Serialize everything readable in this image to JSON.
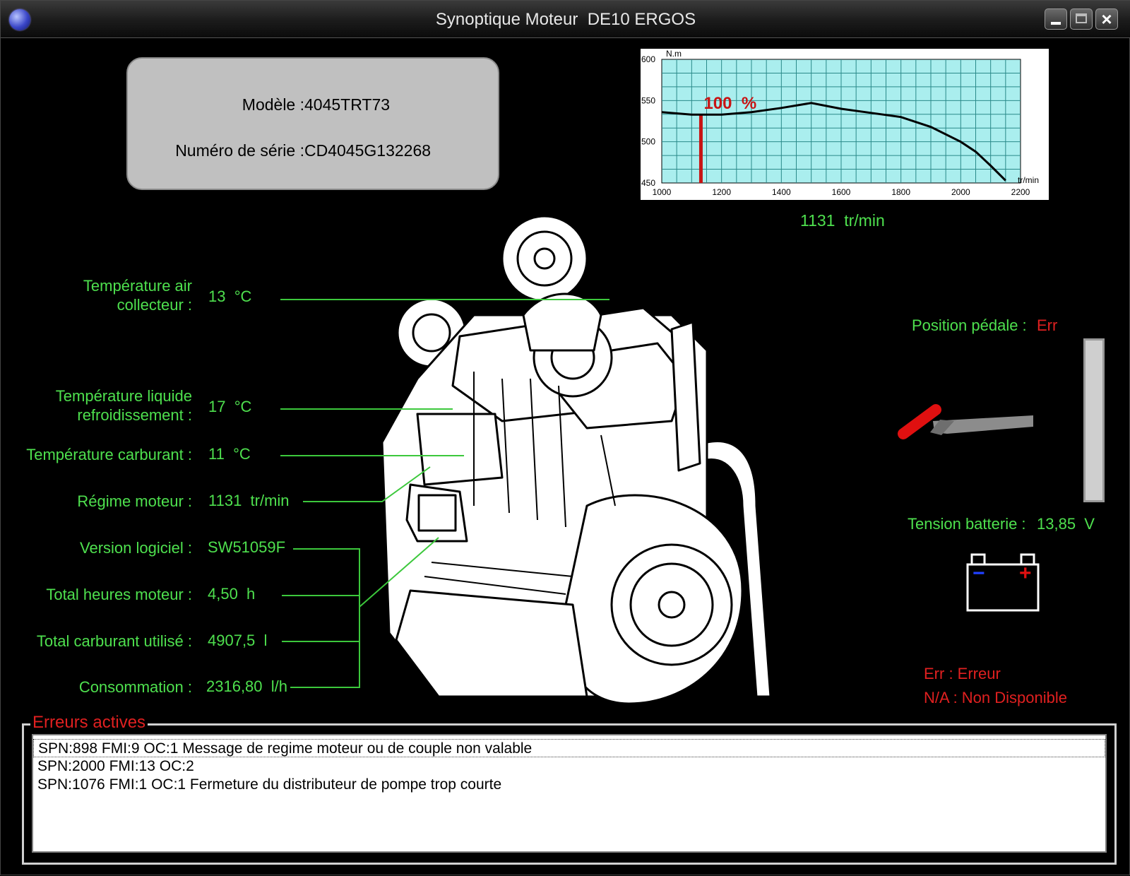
{
  "window": {
    "title": "Synoptique Moteur  DE10 ERGOS"
  },
  "info": {
    "model_label": "Modèle :",
    "model_value": "4045TRT73",
    "serial_label": "Numéro de série :",
    "serial_value": "CD4045G132268"
  },
  "chart_data": {
    "type": "line",
    "title": "",
    "ylabel": "N.m",
    "xlabel": "tr/min",
    "xlim": [
      1000,
      2200
    ],
    "ylim": [
      450,
      600
    ],
    "x_ticks": [
      1000,
      1200,
      1400,
      1600,
      1800,
      2000,
      2200
    ],
    "y_ticks": [
      450,
      500,
      550,
      600
    ],
    "grid": true,
    "series": [
      {
        "x": [
          1000,
          1100,
          1200,
          1300,
          1400,
          1500,
          1600,
          1700,
          1800,
          1900,
          2000,
          2050,
          2100,
          2150
        ],
        "y": [
          536,
          533,
          533,
          536,
          541,
          547,
          540,
          535,
          530,
          518,
          500,
          488,
          471,
          453
        ]
      }
    ],
    "marker_x": 1131,
    "annotation": "100  %",
    "colors": {
      "line": "#000000",
      "marker": "#c81414",
      "plot_bg": "#aaeeee",
      "grid": "#2a8a8a"
    }
  },
  "chart_readout": "1131  tr/min",
  "params": {
    "air_temp": {
      "label": "Température air\ncollecteur :",
      "value": "13  °C"
    },
    "coolant_temp": {
      "label": "Température liquide\nrefroidissement :",
      "value": "17  °C"
    },
    "fuel_temp": {
      "label": "Température carburant :",
      "value": "11  °C"
    },
    "engine_speed": {
      "label": "Régime moteur :",
      "value": "1131  tr/min"
    },
    "software": {
      "label": "Version logiciel :",
      "value": "SW51059F"
    },
    "hours": {
      "label": "Total heures moteur :",
      "value": "4,50  h"
    },
    "fuel_used": {
      "label": "Total carburant utilisé :",
      "value": "4907,5  l"
    },
    "consumption": {
      "label": "Consommation :",
      "value": "2316,80  l/h"
    }
  },
  "pedal": {
    "label": "Position pédale :",
    "value": "Err"
  },
  "battery": {
    "label": "Tension batterie :",
    "value": "13,85  V",
    "minus": "−",
    "plus": "+"
  },
  "legend": {
    "err": "Err : Erreur",
    "na": "N/A : Non Disponible"
  },
  "errors": {
    "title": "Erreurs actives",
    "items": [
      "SPN:898 FMI:9 OC:1 Message de regime moteur ou de couple non valable",
      "SPN:2000 FMI:13 OC:2",
      "SPN:1076 FMI:1 OC:1 Fermeture du distributeur de pompe trop courte"
    ]
  },
  "icons": {
    "app": "globe-icon",
    "pedal": "accelerator-pedal-icon",
    "battery": "battery-icon",
    "engine": "engine-illustration"
  }
}
